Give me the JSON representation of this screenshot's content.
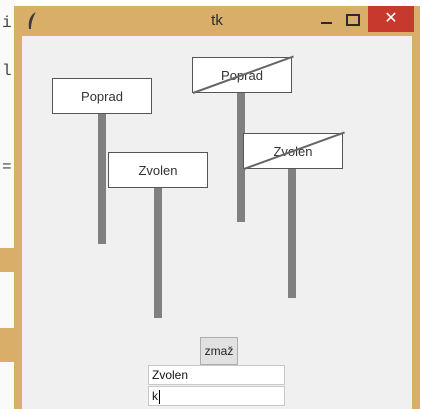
{
  "background": {
    "code_chars": [
      "i",
      "l",
      "="
    ]
  },
  "window": {
    "title": "tk",
    "close_glyph": "✕",
    "colors": {
      "frame": "#d8ae69",
      "close": "#c7392c",
      "client": "#f0f0f0"
    }
  },
  "canvas": {
    "signs": [
      {
        "label": "Poprad",
        "struck": false
      },
      {
        "label": "Zvolen",
        "struck": false
      },
      {
        "label": "Poprad",
        "struck": true
      },
      {
        "label": "Zvolen",
        "struck": true
      }
    ]
  },
  "controls": {
    "button_label": "zmaž",
    "entry1_value": "Zvolen",
    "entry2_value": "k"
  }
}
